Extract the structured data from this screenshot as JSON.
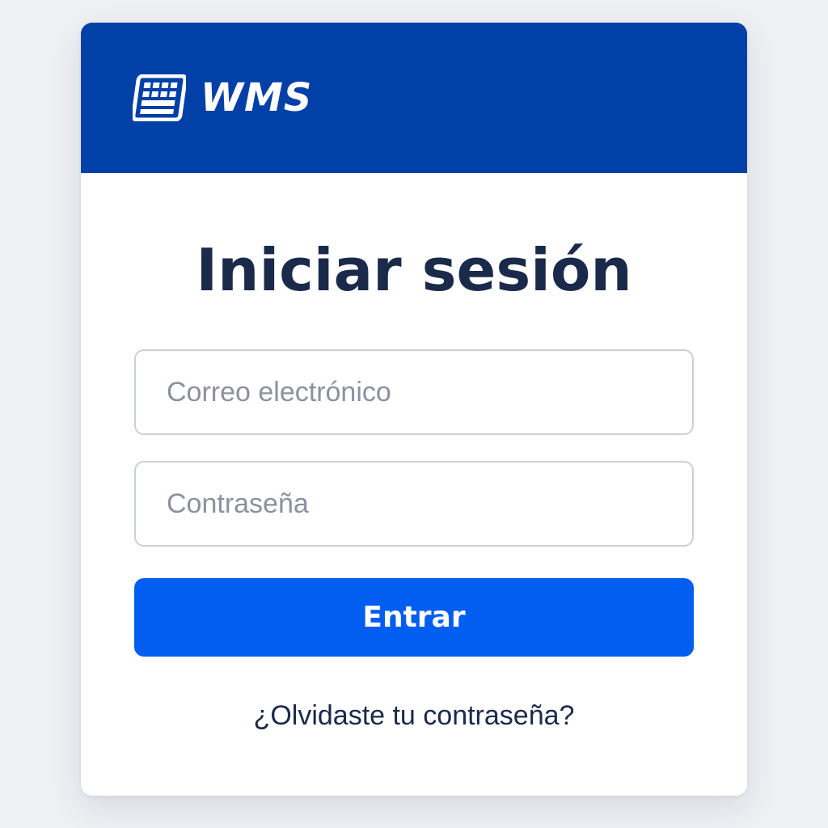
{
  "brand": {
    "name": "WMS",
    "icon": "keyboard-icon",
    "header_color": "#0140a7"
  },
  "login": {
    "title": "Iniciar sesión",
    "email_placeholder": "Correo electrónico",
    "email_value": "",
    "password_placeholder": "Contraseña",
    "password_value": "",
    "submit_label": "Entrar",
    "submit_color": "#025ef0",
    "forgot_link": "¿Olvidaste tu contraseña?"
  }
}
